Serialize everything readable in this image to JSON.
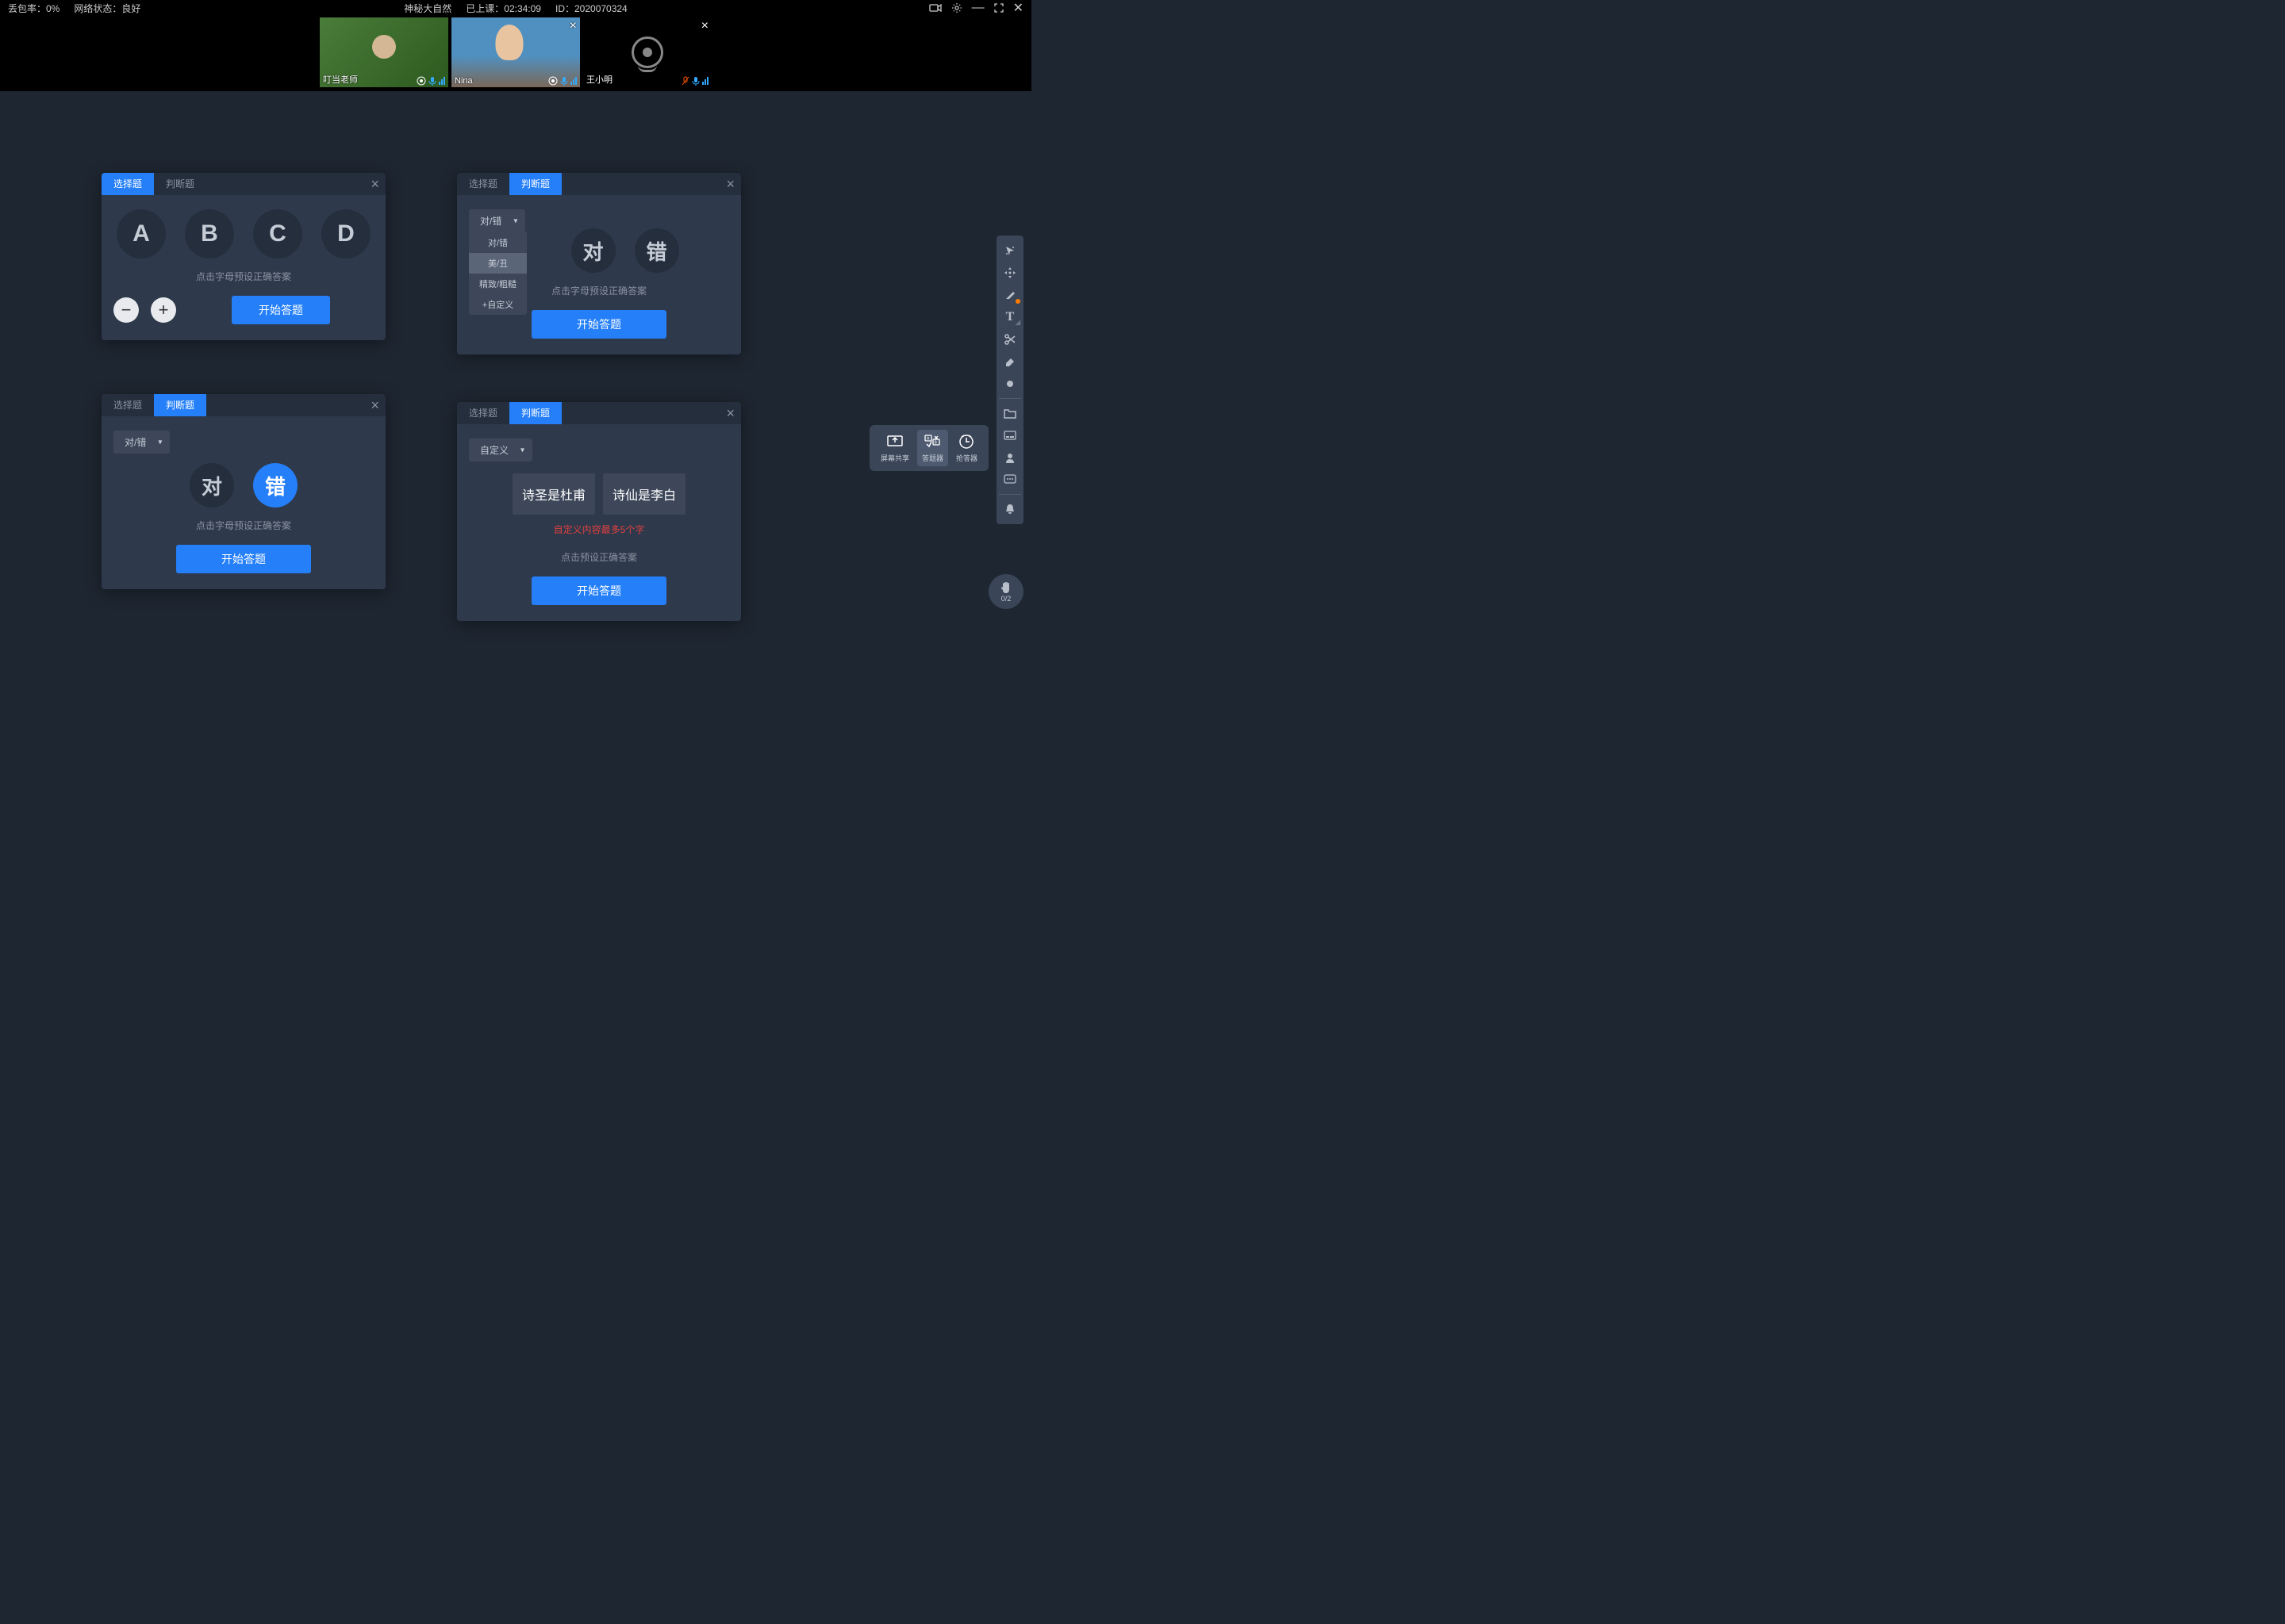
{
  "topbar": {
    "packet_loss": "丢包率：0%",
    "network": "网络状态：良好",
    "title": "神秘大自然",
    "class_time": "已上课：02:34:09",
    "class_id": "ID：2020070324"
  },
  "videos": {
    "teacher": "叮当老师",
    "student1": "Nina",
    "student2": "王小明"
  },
  "panels": {
    "mcq": {
      "tab1": "选择题",
      "tab2": "判断题",
      "hint": "点击字母预设正确答案",
      "options": [
        "A",
        "B",
        "C",
        "D"
      ],
      "start": "开始答题"
    },
    "tf_dropdown": {
      "tab1": "选择题",
      "tab2": "判断题",
      "dd_label": "对/错",
      "items": [
        "对/错",
        "美/丑",
        "精致/粗糙",
        "+自定义"
      ],
      "opt1": "对",
      "opt2": "错",
      "hint": "点击字母预设正确答案",
      "start": "开始答题"
    },
    "tf_answer": {
      "tab1": "选择题",
      "tab2": "判断题",
      "dd_label": "对/错",
      "opt1": "对",
      "opt2": "错",
      "hint": "点击字母预设正确答案",
      "start": "开始答题"
    },
    "custom": {
      "tab1": "选择题",
      "tab2": "判断题",
      "dd_label": "自定义",
      "box1": "诗圣是杜甫",
      "box2": "诗仙是李白",
      "error": "自定义内容最多5个字",
      "hint": "点击预设正确答案",
      "start": "开始答题"
    }
  },
  "actions": {
    "share": "屏幕共享",
    "answer": "答题器",
    "buzzer": "抢答器"
  },
  "hand": {
    "count": "0/2"
  }
}
